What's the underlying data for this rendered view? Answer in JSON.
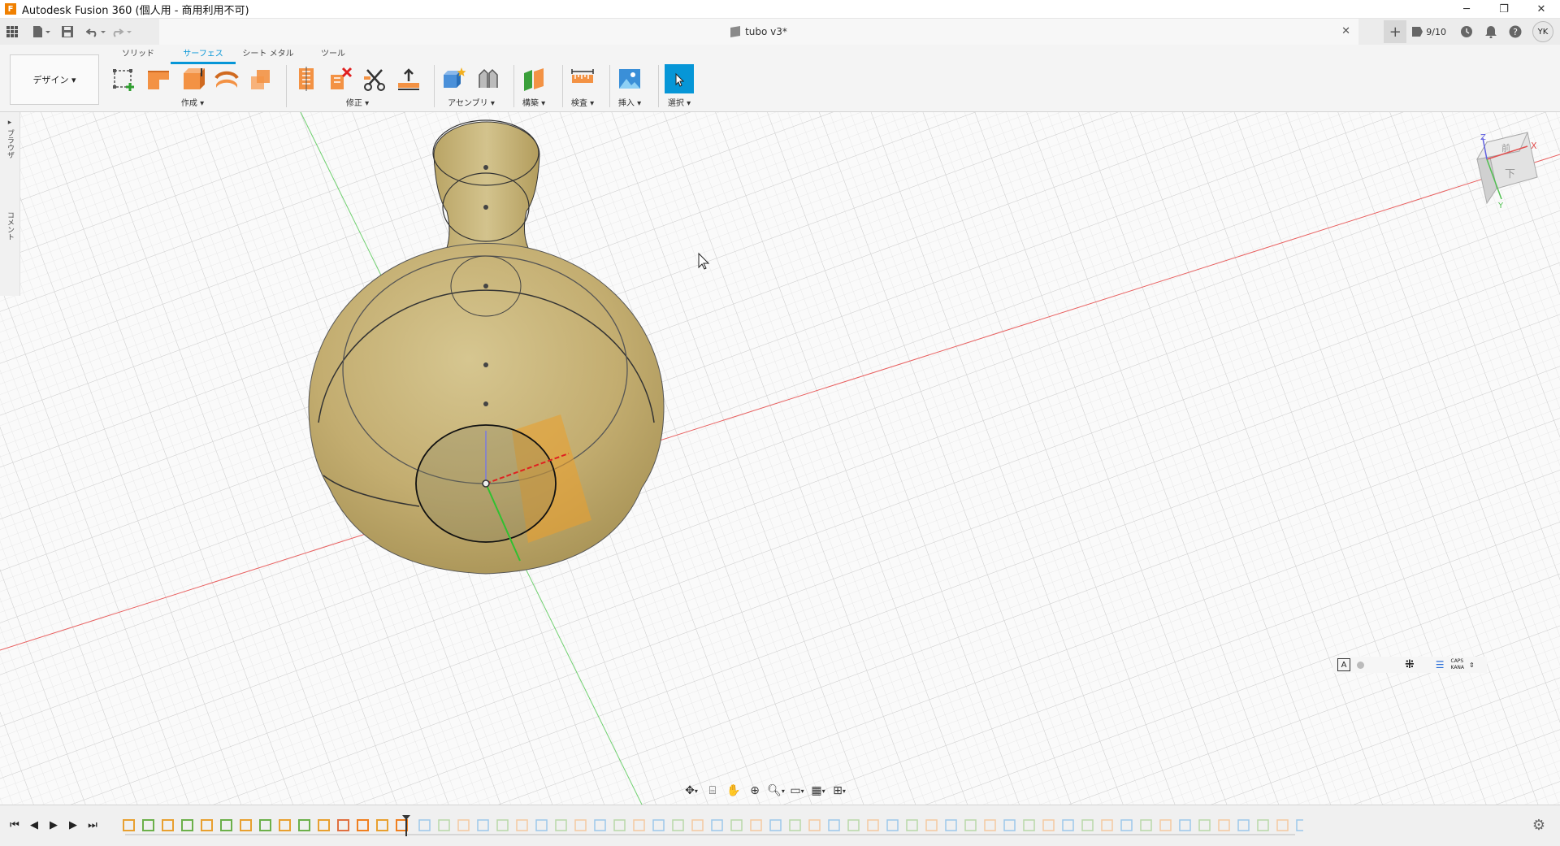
{
  "window": {
    "title": "Autodesk Fusion 360 (個人用 - 商用利用不可)",
    "logo": "F",
    "minimize": "─",
    "restore": "❐",
    "close": "✕"
  },
  "quick_access": {
    "doc_title": "tubo v3*",
    "doc_close": "✕",
    "job_status": "9/10",
    "user_initials": "YK"
  },
  "ribbon": {
    "tabs": [
      {
        "label": "ソリッド",
        "active": false
      },
      {
        "label": "サーフェス",
        "active": true
      },
      {
        "label": "シート メタル",
        "active": false
      },
      {
        "label": "ツール",
        "active": false
      }
    ],
    "workspace": "デザイン ▾",
    "groups": {
      "create": "作成 ▾",
      "modify": "修正 ▾",
      "assemble": "アセンブリ ▾",
      "construct": "構築 ▾",
      "inspect": "検査 ▾",
      "insert": "挿入 ▾",
      "select": "選択 ▾"
    }
  },
  "left_panel": {
    "browser": "▸ ブラウザ",
    "comments": "コメント"
  },
  "viewcube": {
    "top": "前",
    "front": "下",
    "axis_x": "X",
    "axis_y": "Y",
    "axis_z": "Z"
  },
  "status_tray": {
    "caps": "CAPS",
    "kana": "KANA"
  },
  "colors": {
    "accent": "#0696d7",
    "body": "#c8b278",
    "plane": "#e8a030",
    "axis_x": "#e04040",
    "axis_y": "#40c040"
  }
}
